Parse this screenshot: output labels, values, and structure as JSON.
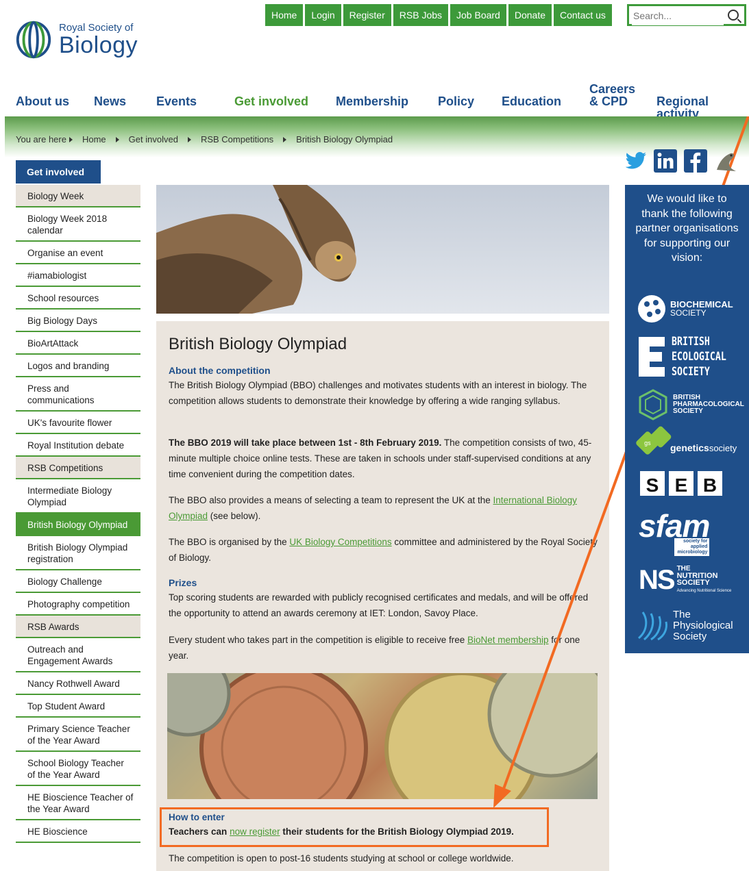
{
  "topnav": {
    "items": [
      "Home",
      "Login",
      "Register",
      "RSB Jobs",
      "Job Board",
      "Donate",
      "Contact us"
    ],
    "search_placeholder": "Search..."
  },
  "logo": {
    "line1": "Royal Society of",
    "line2": "Biology"
  },
  "mainnav": {
    "items": [
      "About us",
      "News",
      "Events",
      "Get involved",
      "Membership",
      "Policy",
      "Education",
      "Careers & CPD",
      "Regional activity"
    ],
    "careers_line1": "Careers",
    "careers_line2": "& CPD",
    "active": "Get involved"
  },
  "breadcrumb": {
    "label": "You are here",
    "items": [
      "Home",
      "Get involved",
      "RSB Competitions",
      "British Biology Olympiad"
    ]
  },
  "sidebar": {
    "title": "Get involved",
    "items": [
      {
        "label": "Biology Week",
        "type": "cat"
      },
      {
        "label": "Biology Week 2018 calendar",
        "type": "sub"
      },
      {
        "label": "Organise an event",
        "type": "sub"
      },
      {
        "label": "#iamabiologist",
        "type": "sub"
      },
      {
        "label": "School resources",
        "type": "sub"
      },
      {
        "label": "Big Biology Days",
        "type": "sub"
      },
      {
        "label": "BioArtAttack",
        "type": "sub"
      },
      {
        "label": "Logos and branding",
        "type": "sub"
      },
      {
        "label": "Press and communications",
        "type": "sub"
      },
      {
        "label": "UK's favourite flower",
        "type": "sub"
      },
      {
        "label": "Royal Institution debate",
        "type": "sub"
      },
      {
        "label": "RSB Competitions",
        "type": "cat"
      },
      {
        "label": "Intermediate Biology Olympiad",
        "type": "sub"
      },
      {
        "label": "British Biology Olympiad",
        "type": "active"
      },
      {
        "label": "British Biology Olympiad registration",
        "type": "sub"
      },
      {
        "label": "Biology Challenge",
        "type": "sub"
      },
      {
        "label": "Photography competition",
        "type": "sub"
      },
      {
        "label": "RSB Awards",
        "type": "cat"
      },
      {
        "label": "Outreach and Engagement Awards",
        "type": "sub"
      },
      {
        "label": "Nancy Rothwell Award",
        "type": "sub"
      },
      {
        "label": "Top Student Award",
        "type": "sub"
      },
      {
        "label": "Primary Science Teacher of the Year Award",
        "type": "sub"
      },
      {
        "label": "School Biology Teacher of the Year Award",
        "type": "sub"
      },
      {
        "label": "HE Bioscience Teacher of the Year Award",
        "type": "sub"
      },
      {
        "label": "HE Bioscience",
        "type": "sub"
      }
    ]
  },
  "content": {
    "title": "British Biology Olympiad",
    "about_heading": "About the competition",
    "about_text": "The British Biology Olympiad (BBO) challenges and motivates students with an interest in biology. The competition allows students to demonstrate their knowledge by offering a wide ranging syllabus.",
    "dates_bold": "The BBO 2019 will take place between 1st - 8th February 2019.",
    "dates_text": " The competition consists of two, 45-minute multiple choice online tests. These are taken in schools under staff-supervised conditions at any time convenient during the competition dates.",
    "select_pre": "The BBO also provides a means of selecting a team to represent the UK at the ",
    "select_link": "International Biology Olympiad",
    "select_post": " (see below).",
    "organised_pre": "The BBO is organised by the ",
    "organised_link": "UK Biology Competitions",
    "organised_post": " committee and administered by the Royal Society of Biology.",
    "prizes_heading": "Prizes",
    "prizes_text": "Top scoring students are rewarded with publicly recognised certificates and medals, and will be offered the opportunity to attend an awards ceremony at IET: London, Savoy Place.",
    "bionet_pre": "Every student who takes part in the competition is eligible to receive free ",
    "bionet_link": "BioNet membership",
    "bionet_post": " for one year.",
    "enter_heading": "How to enter",
    "enter_pre": "Teachers can ",
    "enter_link": "now register",
    "enter_post": " their students for the British Biology Olympiad 2019.",
    "open_text": "The competition is open to post-16 students studying at school or college worldwide."
  },
  "partners": {
    "intro": "We would like to thank the following partner organisations for supporting our vision:",
    "biochem_l1": "BIOCHEMICAL",
    "biochem_l2": "SOCIETY",
    "bes_l1": "BRITISH",
    "bes_l2": "ECOLOGICAL",
    "bes_l3": "SOCIETY",
    "bps_l1": "BRITISH",
    "bps_l2": "PHARMACOLOGICAL",
    "bps_l3": "SOCIETY",
    "gs_mark": "gs",
    "genetics": "genetics",
    "genetics_society": "society",
    "seb": [
      "S",
      "E",
      "B"
    ],
    "sfam": "sfam",
    "sfam_tag_l1": "society for",
    "sfam_tag_l2": "applied microbiology",
    "ns_mark": "NS",
    "ns_l1": "THE",
    "ns_l2": "NUTRITION",
    "ns_l3": "SOCIETY",
    "ns_tag": "Advancing Nutritional Science",
    "phys_l1": "The",
    "phys_l2": "Physiological",
    "phys_l3": "Society"
  },
  "colors": {
    "brand_blue": "#1f4f8a",
    "brand_green": "#3d9a3a",
    "highlight_orange": "#f26a22"
  }
}
